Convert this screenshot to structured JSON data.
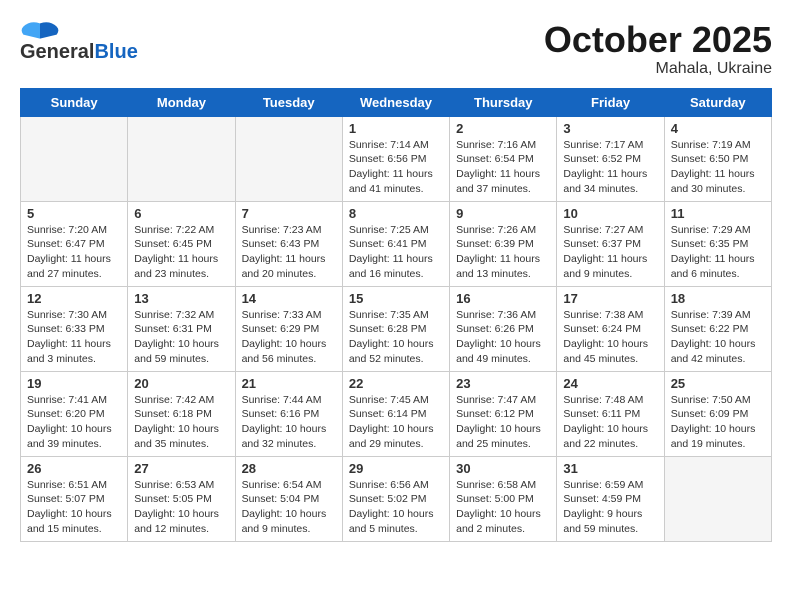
{
  "header": {
    "logo_general": "General",
    "logo_blue": "Blue",
    "month_title": "October 2025",
    "subtitle": "Mahala, Ukraine"
  },
  "weekdays": [
    "Sunday",
    "Monday",
    "Tuesday",
    "Wednesday",
    "Thursday",
    "Friday",
    "Saturday"
  ],
  "weeks": [
    [
      {
        "day": "",
        "info": ""
      },
      {
        "day": "",
        "info": ""
      },
      {
        "day": "",
        "info": ""
      },
      {
        "day": "1",
        "info": "Sunrise: 7:14 AM\nSunset: 6:56 PM\nDaylight: 11 hours\nand 41 minutes."
      },
      {
        "day": "2",
        "info": "Sunrise: 7:16 AM\nSunset: 6:54 PM\nDaylight: 11 hours\nand 37 minutes."
      },
      {
        "day": "3",
        "info": "Sunrise: 7:17 AM\nSunset: 6:52 PM\nDaylight: 11 hours\nand 34 minutes."
      },
      {
        "day": "4",
        "info": "Sunrise: 7:19 AM\nSunset: 6:50 PM\nDaylight: 11 hours\nand 30 minutes."
      }
    ],
    [
      {
        "day": "5",
        "info": "Sunrise: 7:20 AM\nSunset: 6:47 PM\nDaylight: 11 hours\nand 27 minutes."
      },
      {
        "day": "6",
        "info": "Sunrise: 7:22 AM\nSunset: 6:45 PM\nDaylight: 11 hours\nand 23 minutes."
      },
      {
        "day": "7",
        "info": "Sunrise: 7:23 AM\nSunset: 6:43 PM\nDaylight: 11 hours\nand 20 minutes."
      },
      {
        "day": "8",
        "info": "Sunrise: 7:25 AM\nSunset: 6:41 PM\nDaylight: 11 hours\nand 16 minutes."
      },
      {
        "day": "9",
        "info": "Sunrise: 7:26 AM\nSunset: 6:39 PM\nDaylight: 11 hours\nand 13 minutes."
      },
      {
        "day": "10",
        "info": "Sunrise: 7:27 AM\nSunset: 6:37 PM\nDaylight: 11 hours\nand 9 minutes."
      },
      {
        "day": "11",
        "info": "Sunrise: 7:29 AM\nSunset: 6:35 PM\nDaylight: 11 hours\nand 6 minutes."
      }
    ],
    [
      {
        "day": "12",
        "info": "Sunrise: 7:30 AM\nSunset: 6:33 PM\nDaylight: 11 hours\nand 3 minutes."
      },
      {
        "day": "13",
        "info": "Sunrise: 7:32 AM\nSunset: 6:31 PM\nDaylight: 10 hours\nand 59 minutes."
      },
      {
        "day": "14",
        "info": "Sunrise: 7:33 AM\nSunset: 6:29 PM\nDaylight: 10 hours\nand 56 minutes."
      },
      {
        "day": "15",
        "info": "Sunrise: 7:35 AM\nSunset: 6:28 PM\nDaylight: 10 hours\nand 52 minutes."
      },
      {
        "day": "16",
        "info": "Sunrise: 7:36 AM\nSunset: 6:26 PM\nDaylight: 10 hours\nand 49 minutes."
      },
      {
        "day": "17",
        "info": "Sunrise: 7:38 AM\nSunset: 6:24 PM\nDaylight: 10 hours\nand 45 minutes."
      },
      {
        "day": "18",
        "info": "Sunrise: 7:39 AM\nSunset: 6:22 PM\nDaylight: 10 hours\nand 42 minutes."
      }
    ],
    [
      {
        "day": "19",
        "info": "Sunrise: 7:41 AM\nSunset: 6:20 PM\nDaylight: 10 hours\nand 39 minutes."
      },
      {
        "day": "20",
        "info": "Sunrise: 7:42 AM\nSunset: 6:18 PM\nDaylight: 10 hours\nand 35 minutes."
      },
      {
        "day": "21",
        "info": "Sunrise: 7:44 AM\nSunset: 6:16 PM\nDaylight: 10 hours\nand 32 minutes."
      },
      {
        "day": "22",
        "info": "Sunrise: 7:45 AM\nSunset: 6:14 PM\nDaylight: 10 hours\nand 29 minutes."
      },
      {
        "day": "23",
        "info": "Sunrise: 7:47 AM\nSunset: 6:12 PM\nDaylight: 10 hours\nand 25 minutes."
      },
      {
        "day": "24",
        "info": "Sunrise: 7:48 AM\nSunset: 6:11 PM\nDaylight: 10 hours\nand 22 minutes."
      },
      {
        "day": "25",
        "info": "Sunrise: 7:50 AM\nSunset: 6:09 PM\nDaylight: 10 hours\nand 19 minutes."
      }
    ],
    [
      {
        "day": "26",
        "info": "Sunrise: 6:51 AM\nSunset: 5:07 PM\nDaylight: 10 hours\nand 15 minutes."
      },
      {
        "day": "27",
        "info": "Sunrise: 6:53 AM\nSunset: 5:05 PM\nDaylight: 10 hours\nand 12 minutes."
      },
      {
        "day": "28",
        "info": "Sunrise: 6:54 AM\nSunset: 5:04 PM\nDaylight: 10 hours\nand 9 minutes."
      },
      {
        "day": "29",
        "info": "Sunrise: 6:56 AM\nSunset: 5:02 PM\nDaylight: 10 hours\nand 5 minutes."
      },
      {
        "day": "30",
        "info": "Sunrise: 6:58 AM\nSunset: 5:00 PM\nDaylight: 10 hours\nand 2 minutes."
      },
      {
        "day": "31",
        "info": "Sunrise: 6:59 AM\nSunset: 4:59 PM\nDaylight: 9 hours\nand 59 minutes."
      },
      {
        "day": "",
        "info": ""
      }
    ]
  ]
}
